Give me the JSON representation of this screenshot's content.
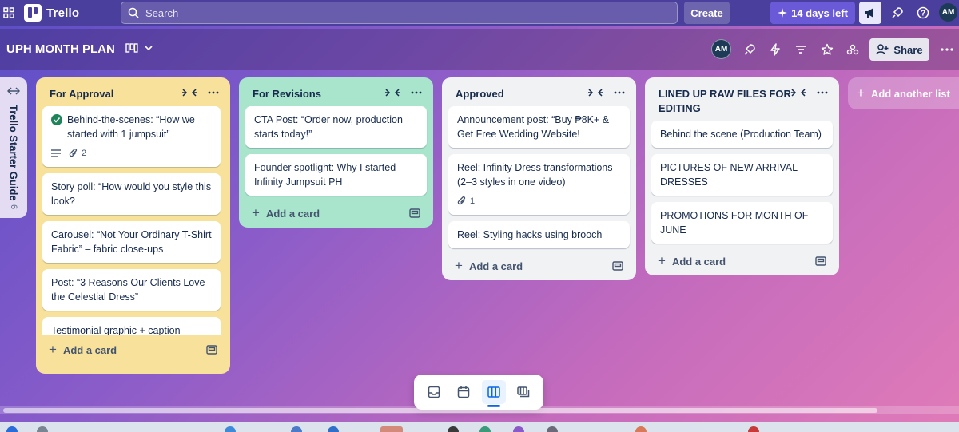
{
  "topbar": {
    "logo_text": "Trello",
    "search_placeholder": "Search",
    "create_label": "Create",
    "trial_label": "14 days left",
    "avatar_initials": "AM"
  },
  "board": {
    "title": "UPH MONTH PLAN",
    "avatar_initials": "AM",
    "share_label": "Share"
  },
  "collapsed_list": {
    "title": "Trello Starter Guide",
    "count": "6"
  },
  "lists": [
    {
      "title": "For Approval",
      "cards": [
        {
          "text": "Behind-the-scenes: “How we started with 1 jumpsuit”",
          "done": true,
          "attachments": "2"
        },
        {
          "text": "Story poll: “How would you style this look?"
        },
        {
          "text": "Carousel: “Not Your Ordinary T-Shirt Fabric” – fabric close-ups"
        },
        {
          "text": "Post: “3 Reasons Our Clients Love the Celestial Dress”"
        },
        {
          "text": "Testimonial graphic + caption"
        }
      ],
      "add_label": "Add a card"
    },
    {
      "title": "For Revisions",
      "cards": [
        {
          "text": "CTA Post: “Order now, production starts today!”"
        },
        {
          "text": "Founder spotlight: Why I started Infinity Jumpsuit PH"
        }
      ],
      "add_label": "Add a card"
    },
    {
      "title": "Approved",
      "cards": [
        {
          "text": "Announcement post: “Buy ₱8K+ & Get Free Wedding Website!"
        },
        {
          "text": "Reel: Infinity Dress transformations (2–3 styles in one video)",
          "attachments": "1"
        },
        {
          "text": "Reel: Styling hacks using brooch"
        }
      ],
      "add_label": "Add a card"
    },
    {
      "title": "LINED UP RAW FILES FOR EDITING",
      "cards": [
        {
          "text": "Behind the scene (Production Team)"
        },
        {
          "text": "PICTURES OF NEW ARRIVAL DRESSES"
        },
        {
          "text": "PROMOTIONS FOR MONTH OF JUNE"
        }
      ],
      "add_label": "Add a card"
    }
  ],
  "add_list_label": "Add another list",
  "colors": {
    "list_approval": "#f8e29b",
    "list_revisions": "#a8e5cc",
    "list_default": "#f1f2f4",
    "accent": "#0c66e4"
  }
}
